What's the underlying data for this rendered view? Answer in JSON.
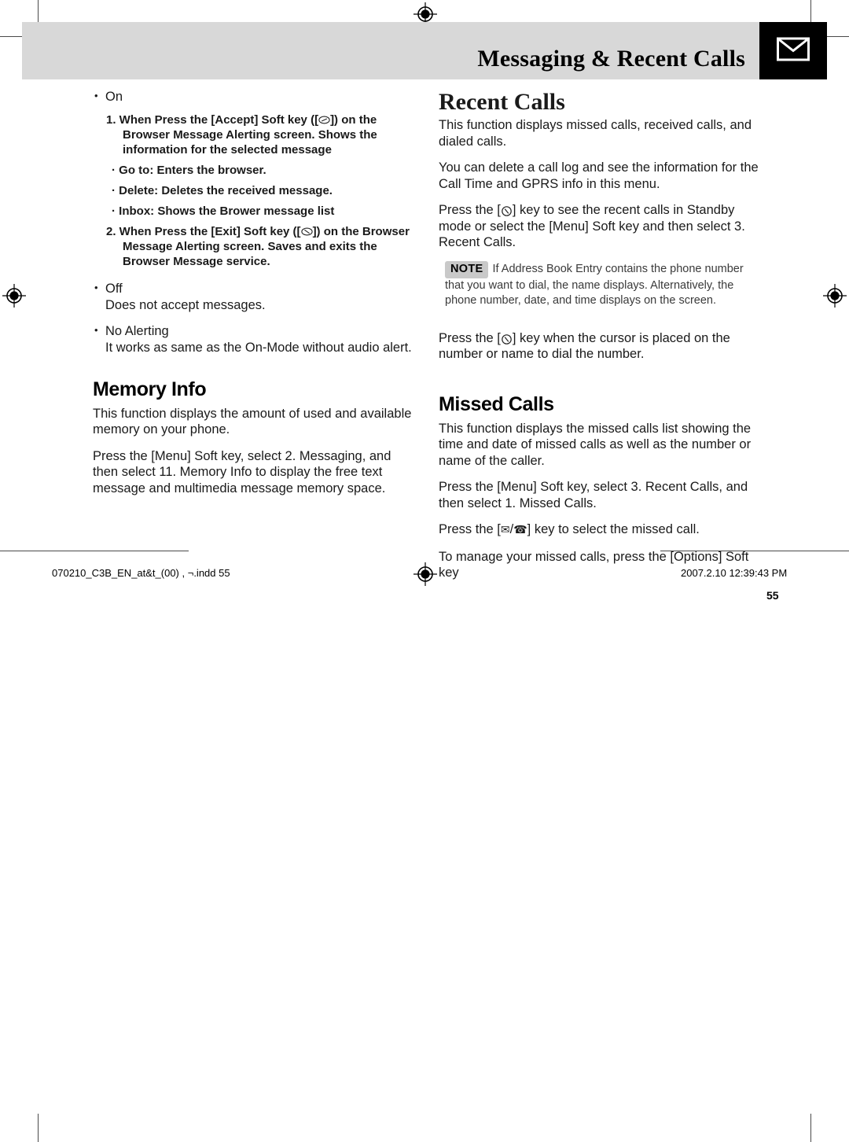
{
  "header": {
    "title": "Messaging & Recent Calls",
    "icon": "envelope-icon"
  },
  "left_column": {
    "bullet_on": "On",
    "steps": [
      "1. When Press the [Accept] Soft key ([",
      "2. When Press the [Exit] Soft key (["
    ],
    "step1_tail": "]) on the Browser Message Alerting screen. Shows the information for the selected message",
    "step2_tail": "]) on the Browser Message Alerting screen. Saves and exits the Browser Message service.",
    "sub_items": [
      "· Go to: Enters the browser.",
      "· Delete: Deletes the received message.",
      "· Inbox: Shows the Brower message list"
    ],
    "bullet_off": "Off",
    "off_body": "Does not accept messages.",
    "bullet_no_alerting": "No Alerting",
    "no_alerting_body": "It works as same as the On-Mode without audio alert.",
    "memory_info": {
      "heading": "Memory Info",
      "paragraph1": "This function displays the amount of used and available memory on your phone.",
      "paragraph2": "Press the [Menu] Soft key, select 2. Messaging, and then select 11. Memory Info to display the free text message and multimedia message memory space."
    }
  },
  "right_column": {
    "recent_calls": {
      "heading": "Recent Calls",
      "paragraph1": "This function displays missed calls, received calls, and dialed calls.",
      "paragraph2": "You can delete a call log and see the information for the Call Time and GPRS info in this menu.",
      "paragraph3_pre": "Press the [",
      "paragraph3_post": "] key to see the recent calls in Standby mode or select the [Menu] Soft key and then select 3. Recent Calls.",
      "note_tag": "NOTE",
      "note_text": "If Address Book Entry contains the phone number that you want to dial, the name displays. Alternatively, the phone number, date, and time displays on the screen.",
      "paragraph4_pre": "Press the [",
      "paragraph4_post": "] key when the cursor is placed on the number or name to dial the number."
    },
    "missed_calls": {
      "heading": "Missed Calls",
      "paragraph1": "This function displays the missed calls list showing the time and date of missed calls as well as the number or name of the caller.",
      "paragraph2": "Press the [Menu] Soft key, select 3. Recent Calls, and then select 1. Missed Calls.",
      "paragraph3_pre": "Press the [",
      "paragraph3_mid": "/",
      "paragraph3_post": "] key to select the missed call.",
      "envelope_glyph": "✉",
      "phone_glyph": "☎",
      "paragraph4": "To manage your missed calls, press the [Options] Soft key"
    }
  },
  "page_number": "55",
  "footer": {
    "file_info": "070210_C3B_EN_at&t_(00) , ¬.indd   55",
    "timestamp": "2007.2.10   12:39:43 PM"
  },
  "colors": {
    "header_band": "#d8d8d8",
    "icon_box": "#000000",
    "note_tag": "#c9c9c9",
    "text": "#1a1a1a"
  }
}
